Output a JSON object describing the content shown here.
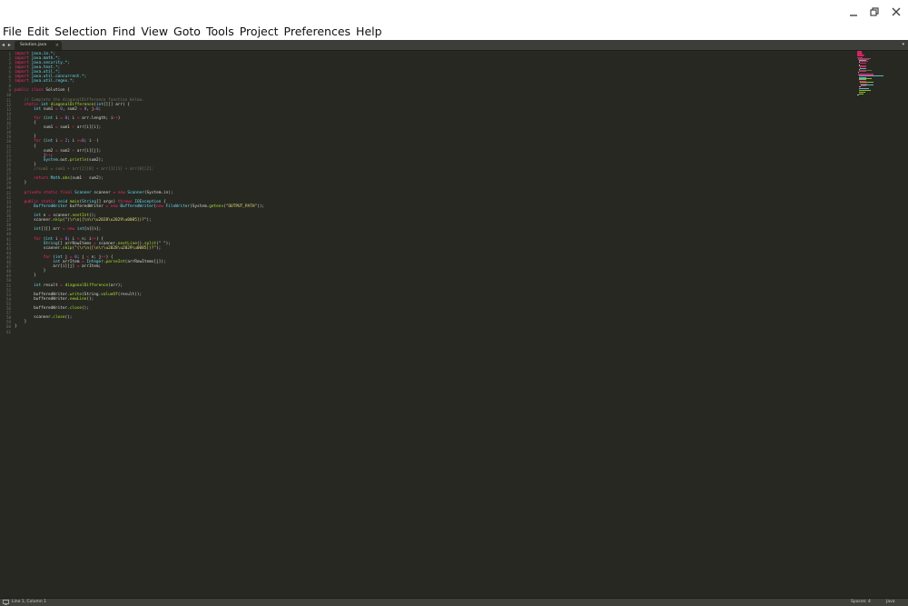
{
  "window": {
    "minimize_icon": "minimize-icon",
    "restore_icon": "restore-icon",
    "close_icon": "close-icon"
  },
  "menu": [
    "File",
    "Edit",
    "Selection",
    "Find",
    "View",
    "Goto",
    "Tools",
    "Project",
    "Preferences",
    "Help"
  ],
  "tabs": {
    "nav_glyph": "◂ ▸",
    "active": {
      "label": "Solution.java",
      "close": "×"
    },
    "dropdown_glyph": "▾"
  },
  "editor": {
    "colors": {
      "background": "#272822",
      "keyword": "#f92672",
      "type": "#66d9ef",
      "string": "#e6db74",
      "comment": "#75715e",
      "number": "#ae81ff",
      "function": "#a6e22e",
      "plain": "#d8d8d2"
    },
    "lines": [
      [
        [
          "import",
          "k"
        ],
        [
          " java.io.*;",
          "t"
        ]
      ],
      [
        [
          "import",
          "k"
        ],
        [
          " java.math.*;",
          "t"
        ]
      ],
      [
        [
          "import",
          "k"
        ],
        [
          " java.security.*;",
          "t"
        ]
      ],
      [
        [
          "import",
          "k"
        ],
        [
          " java.text.*;",
          "t"
        ]
      ],
      [
        [
          "import",
          "k"
        ],
        [
          " java.util.*;",
          "t"
        ]
      ],
      [
        [
          "import",
          "k"
        ],
        [
          " java.util.concurrent.*;",
          "t"
        ]
      ],
      [
        [
          "import",
          "k"
        ],
        [
          " java.util.regex.*;",
          "t"
        ]
      ],
      [],
      [
        [
          "public",
          "k"
        ],
        [
          " ",
          "p"
        ],
        [
          "class",
          "k"
        ],
        [
          " Solution {",
          "p"
        ]
      ],
      [],
      [
        [
          "    // Complete the diagonalDifference function below.",
          "c"
        ]
      ],
      [
        [
          "    ",
          "p"
        ],
        [
          "static",
          "k"
        ],
        [
          " ",
          "p"
        ],
        [
          "int",
          "t"
        ],
        [
          " ",
          "p"
        ],
        [
          "diagonalDifference",
          "f"
        ],
        [
          "(",
          "p"
        ],
        [
          "int",
          "t"
        ],
        [
          "[][] arr) {",
          "p"
        ]
      ],
      [
        [
          "        ",
          "p"
        ],
        [
          "int",
          "t"
        ],
        [
          " sum1 ",
          "p"
        ],
        [
          "=",
          "k"
        ],
        [
          " ",
          "p"
        ],
        [
          "0",
          "n"
        ],
        [
          ", sum2 ",
          "p"
        ],
        [
          "=",
          "k"
        ],
        [
          " ",
          "p"
        ],
        [
          "0",
          "n"
        ],
        [
          ", j",
          "p"
        ],
        [
          "=",
          "k"
        ],
        [
          "0",
          "n"
        ],
        [
          ";",
          "p"
        ]
      ],
      [],
      [
        [
          "        ",
          "p"
        ],
        [
          "for",
          "k"
        ],
        [
          " (",
          "p"
        ],
        [
          "int",
          "t"
        ],
        [
          " i ",
          "p"
        ],
        [
          "=",
          "k"
        ],
        [
          " ",
          "p"
        ],
        [
          "0",
          "n"
        ],
        [
          "; i ",
          "p"
        ],
        [
          "<",
          "k"
        ],
        [
          " arr.length; i",
          "p"
        ],
        [
          "++",
          "k"
        ],
        [
          ")",
          "p"
        ]
      ],
      [
        [
          "        {",
          "p"
        ]
      ],
      [
        [
          "            sum1 ",
          "p"
        ],
        [
          "=",
          "k"
        ],
        [
          " sum1 ",
          "p"
        ],
        [
          "+",
          "k"
        ],
        [
          " arr[i][i];",
          "p"
        ]
      ],
      [],
      [
        [
          "        }",
          "p"
        ]
      ],
      [
        [
          "        ",
          "p"
        ],
        [
          "for",
          "k"
        ],
        [
          " (",
          "p"
        ],
        [
          "int",
          "t"
        ],
        [
          " i ",
          "p"
        ],
        [
          "=",
          "k"
        ],
        [
          " ",
          "p"
        ],
        [
          "2",
          "n"
        ],
        [
          "; i ",
          "p"
        ],
        [
          ">=",
          "k"
        ],
        [
          "0",
          "n"
        ],
        [
          "; i",
          "p"
        ],
        [
          "--",
          "k"
        ],
        [
          ")",
          "p"
        ]
      ],
      [
        [
          "        {",
          "p"
        ]
      ],
      [
        [
          "            sum2 ",
          "p"
        ],
        [
          "=",
          "k"
        ],
        [
          " sum2 ",
          "p"
        ],
        [
          "+",
          "k"
        ],
        [
          " arr[i][j];",
          "p"
        ]
      ],
      [
        [
          "            j",
          "p"
        ],
        [
          "++",
          "k"
        ],
        [
          ";",
          "p"
        ]
      ],
      [
        [
          "            System",
          "t"
        ],
        [
          ".out.",
          "p"
        ],
        [
          "println",
          "f"
        ],
        [
          "(sum2);",
          "p"
        ]
      ],
      [
        [
          "        }",
          "p"
        ]
      ],
      [
        [
          "        //sum1 = sum1 + arr[2][0] + arr[1][1] + arr[0][2];",
          "c"
        ]
      ],
      [],
      [
        [
          "        ",
          "p"
        ],
        [
          "return",
          "k"
        ],
        [
          " ",
          "p"
        ],
        [
          "Math",
          "t"
        ],
        [
          ".",
          "p"
        ],
        [
          "abs",
          "f"
        ],
        [
          "(sum1 ",
          "p"
        ],
        [
          "-",
          "k"
        ],
        [
          " sum2);",
          "p"
        ]
      ],
      [
        [
          "    }",
          "p"
        ]
      ],
      [],
      [
        [
          "    ",
          "p"
        ],
        [
          "private",
          "k"
        ],
        [
          " ",
          "p"
        ],
        [
          "static",
          "k"
        ],
        [
          " ",
          "p"
        ],
        [
          "final",
          "k"
        ],
        [
          " ",
          "p"
        ],
        [
          "Scanner",
          "t"
        ],
        [
          " scanner ",
          "p"
        ],
        [
          "=",
          "k"
        ],
        [
          " ",
          "p"
        ],
        [
          "new",
          "k"
        ],
        [
          " ",
          "p"
        ],
        [
          "Scanner",
          "t"
        ],
        [
          "(System.in);",
          "p"
        ]
      ],
      [],
      [
        [
          "    ",
          "p"
        ],
        [
          "public",
          "k"
        ],
        [
          " ",
          "p"
        ],
        [
          "static",
          "k"
        ],
        [
          " ",
          "p"
        ],
        [
          "void",
          "t"
        ],
        [
          " ",
          "p"
        ],
        [
          "main",
          "f"
        ],
        [
          "(",
          "p"
        ],
        [
          "String",
          "t"
        ],
        [
          "[] args) ",
          "p"
        ],
        [
          "throws",
          "k"
        ],
        [
          " ",
          "p"
        ],
        [
          "IOException",
          "t"
        ],
        [
          " {",
          "p"
        ]
      ],
      [
        [
          "        ",
          "p"
        ],
        [
          "BufferedWriter",
          "t"
        ],
        [
          " bufferedWriter ",
          "p"
        ],
        [
          "=",
          "k"
        ],
        [
          " ",
          "p"
        ],
        [
          "new",
          "k"
        ],
        [
          " ",
          "p"
        ],
        [
          "BufferedWriter",
          "t"
        ],
        [
          "(",
          "p"
        ],
        [
          "new",
          "k"
        ],
        [
          " ",
          "p"
        ],
        [
          "FileWriter",
          "t"
        ],
        [
          "(System.",
          "p"
        ],
        [
          "getenv",
          "f"
        ],
        [
          "(",
          "p"
        ],
        [
          "\"OUTPUT_PATH\"",
          "s"
        ],
        [
          "));",
          "p"
        ]
      ],
      [],
      [
        [
          "        ",
          "p"
        ],
        [
          "int",
          "t"
        ],
        [
          " n ",
          "p"
        ],
        [
          "=",
          "k"
        ],
        [
          " scanner.",
          "p"
        ],
        [
          "nextInt",
          "f"
        ],
        [
          "();",
          "p"
        ]
      ],
      [
        [
          "        scanner.",
          "p"
        ],
        [
          "skip",
          "f"
        ],
        [
          "(",
          "p"
        ],
        [
          "\"(\\r\\n|[\\n\\r\\u2028\\u2029\\u0085])?\"",
          "s"
        ],
        [
          ");",
          "p"
        ]
      ],
      [],
      [
        [
          "        ",
          "p"
        ],
        [
          "int",
          "t"
        ],
        [
          "[][] arr ",
          "p"
        ],
        [
          "=",
          "k"
        ],
        [
          " ",
          "p"
        ],
        [
          "new",
          "k"
        ],
        [
          " ",
          "p"
        ],
        [
          "int",
          "t"
        ],
        [
          "[n][n];",
          "p"
        ]
      ],
      [],
      [
        [
          "        ",
          "p"
        ],
        [
          "for",
          "k"
        ],
        [
          " (",
          "p"
        ],
        [
          "int",
          "t"
        ],
        [
          " i ",
          "p"
        ],
        [
          "=",
          "k"
        ],
        [
          " ",
          "p"
        ],
        [
          "0",
          "n"
        ],
        [
          "; i ",
          "p"
        ],
        [
          "<",
          "k"
        ],
        [
          " n; i",
          "p"
        ],
        [
          "++",
          "k"
        ],
        [
          ") {",
          "p"
        ]
      ],
      [
        [
          "            ",
          "p"
        ],
        [
          "String",
          "t"
        ],
        [
          "[] arrRowItems ",
          "p"
        ],
        [
          "=",
          "k"
        ],
        [
          " scanner.",
          "p"
        ],
        [
          "nextLine",
          "f"
        ],
        [
          "().",
          "p"
        ],
        [
          "split",
          "f"
        ],
        [
          "(",
          "p"
        ],
        [
          "\" \"",
          "s"
        ],
        [
          ");",
          "p"
        ]
      ],
      [
        [
          "            scanner.",
          "p"
        ],
        [
          "skip",
          "f"
        ],
        [
          "(",
          "p"
        ],
        [
          "\"(\\r\\n|[\\n\\r\\u2028\\u2029\\u0085])?\"",
          "s"
        ],
        [
          ");",
          "p"
        ]
      ],
      [],
      [
        [
          "            ",
          "p"
        ],
        [
          "for",
          "k"
        ],
        [
          " (",
          "p"
        ],
        [
          "int",
          "t"
        ],
        [
          " j ",
          "p"
        ],
        [
          "=",
          "k"
        ],
        [
          " ",
          "p"
        ],
        [
          "0",
          "n"
        ],
        [
          "; j ",
          "p"
        ],
        [
          "<",
          "k"
        ],
        [
          " n; j",
          "p"
        ],
        [
          "++",
          "k"
        ],
        [
          ") {",
          "p"
        ]
      ],
      [
        [
          "                ",
          "p"
        ],
        [
          "int",
          "t"
        ],
        [
          " arrItem ",
          "p"
        ],
        [
          "=",
          "k"
        ],
        [
          " ",
          "p"
        ],
        [
          "Integer",
          "t"
        ],
        [
          ".",
          "p"
        ],
        [
          "parseInt",
          "f"
        ],
        [
          "(arrRowItems[j]);",
          "p"
        ]
      ],
      [
        [
          "                arr[i][j] ",
          "p"
        ],
        [
          "=",
          "k"
        ],
        [
          " arrItem;",
          "p"
        ]
      ],
      [
        [
          "            }",
          "p"
        ]
      ],
      [
        [
          "        }",
          "p"
        ]
      ],
      [],
      [
        [
          "        ",
          "p"
        ],
        [
          "int",
          "t"
        ],
        [
          " result ",
          "p"
        ],
        [
          "=",
          "k"
        ],
        [
          " ",
          "p"
        ],
        [
          "diagonalDifference",
          "f"
        ],
        [
          "(arr);",
          "p"
        ]
      ],
      [],
      [
        [
          "        bufferedWriter.",
          "p"
        ],
        [
          "write",
          "f"
        ],
        [
          "(String.",
          "p"
        ],
        [
          "valueOf",
          "f"
        ],
        [
          "(result));",
          "p"
        ]
      ],
      [
        [
          "        bufferedWriter.",
          "p"
        ],
        [
          "newLine",
          "f"
        ],
        [
          "();",
          "p"
        ]
      ],
      [],
      [
        [
          "        bufferedWriter.",
          "p"
        ],
        [
          "close",
          "f"
        ],
        [
          "();",
          "p"
        ]
      ],
      [],
      [
        [
          "        scanner.",
          "p"
        ],
        [
          "close",
          "f"
        ],
        [
          "();",
          "p"
        ]
      ],
      [
        [
          "    }",
          "p"
        ]
      ],
      [
        [
          "}",
          "p"
        ]
      ],
      []
    ]
  },
  "status": {
    "monitor_icon": "monitor-icon",
    "position": "Line 1, Column 1",
    "indent": "Spaces: 4",
    "syntax": "Java"
  }
}
